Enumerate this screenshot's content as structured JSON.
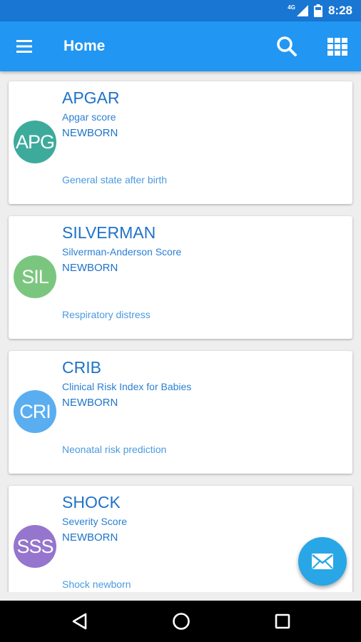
{
  "status_bar": {
    "network": "4G",
    "time": "8:28"
  },
  "app_bar": {
    "title": "Home"
  },
  "icons": {
    "menu": "hamburger-menu-icon",
    "search": "search-icon",
    "grid": "grid-view-icon",
    "fab": "mail-icon",
    "back": "back-triangle-icon",
    "home": "home-circle-icon",
    "recents": "recents-square-icon"
  },
  "cards": [
    {
      "abbr": "APG",
      "title": "APGAR",
      "subtitle": "Apgar score",
      "category": "NEWBORN",
      "description": "General state after birth",
      "color": "#3dab9c"
    },
    {
      "abbr": "SIL",
      "title": "SILVERMAN",
      "subtitle": "Silverman-Anderson Score",
      "category": "NEWBORN",
      "description": "Respiratory distress",
      "color": "#7bc67e"
    },
    {
      "abbr": "CRI",
      "title": "CRIB",
      "subtitle": "Clinical Risk Index for Babies",
      "category": "NEWBORN",
      "description": "Neonatal risk prediction",
      "color": "#5aaef0"
    },
    {
      "abbr": "SSS",
      "title": "SHOCK",
      "subtitle": "Severity Score",
      "category": "NEWBORN",
      "description": "Shock newborn",
      "color": "#9575cd"
    }
  ]
}
